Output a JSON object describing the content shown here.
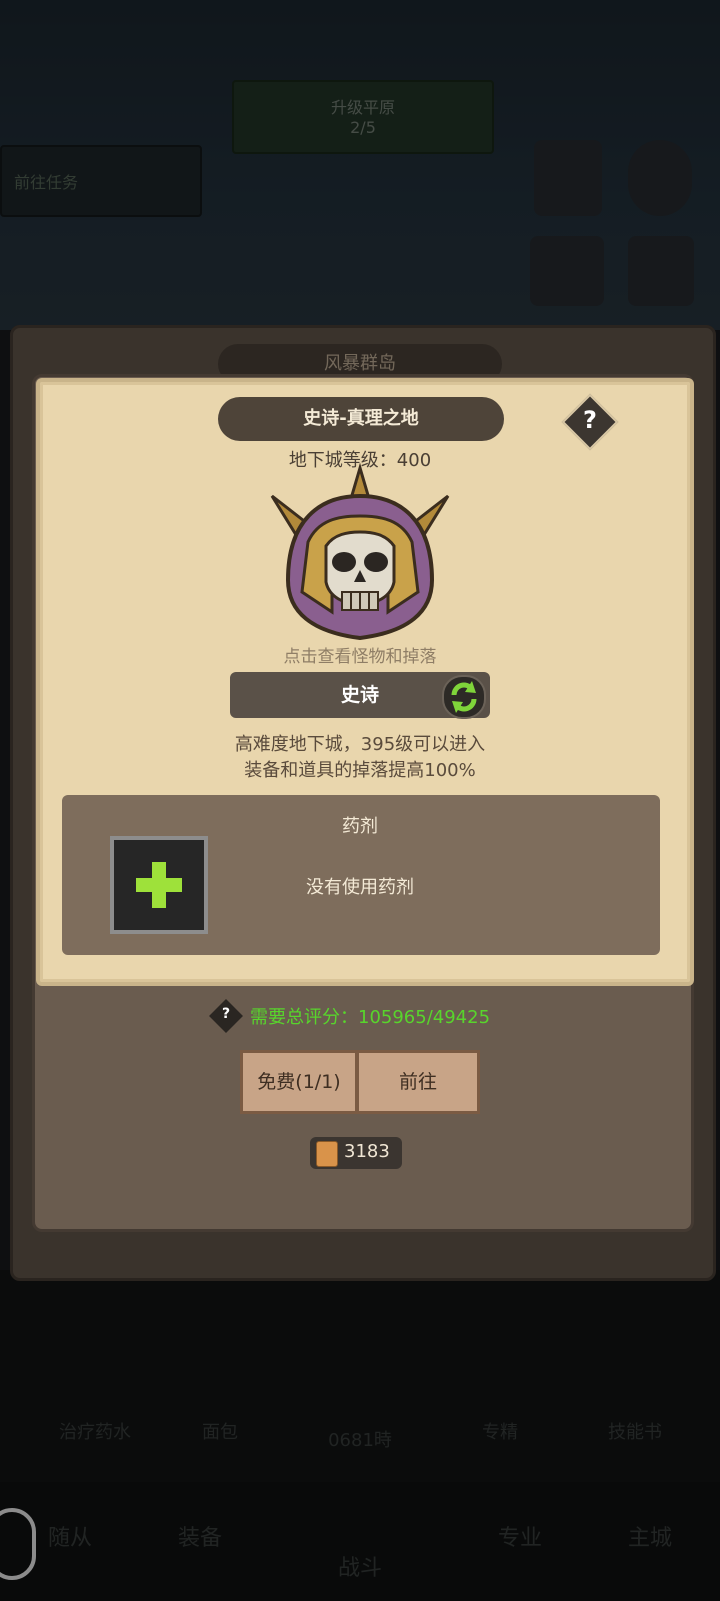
{
  "background": {
    "top_banner_line1": "升级平原",
    "top_banner_line2": "2/5",
    "left_bar_label": "前往任务",
    "outer_title": "风暴群岛",
    "bottom_items": [
      "治疗药水",
      "面包",
      "0681時",
      "专精",
      "技能书"
    ],
    "bottom_nav": [
      "随从",
      "装备",
      "战斗",
      "专业",
      "主城"
    ]
  },
  "dungeon": {
    "title": "史诗-真理之地",
    "level_text": "地下城等级：400",
    "hint": "点击查看怪物和掉落",
    "difficulty": "史诗",
    "desc_line1": "高难度地下城，395级可以进入",
    "desc_line2": "装备和道具的掉落提高100%",
    "help_icon": "?"
  },
  "potion": {
    "title": "药剂",
    "status": "没有使用药剂",
    "slot_icon": "plus-icon"
  },
  "requirement": {
    "icon": "?",
    "text": "需要总评分：105965/49425"
  },
  "buttons": {
    "free": "免费(1/1)",
    "go": "前往"
  },
  "currency": {
    "icon": "scroll-icon",
    "amount": "3183"
  },
  "colors": {
    "score_green": "#58d52c",
    "parchment": "#e9d6ad",
    "plus_green": "#9ee13a"
  }
}
